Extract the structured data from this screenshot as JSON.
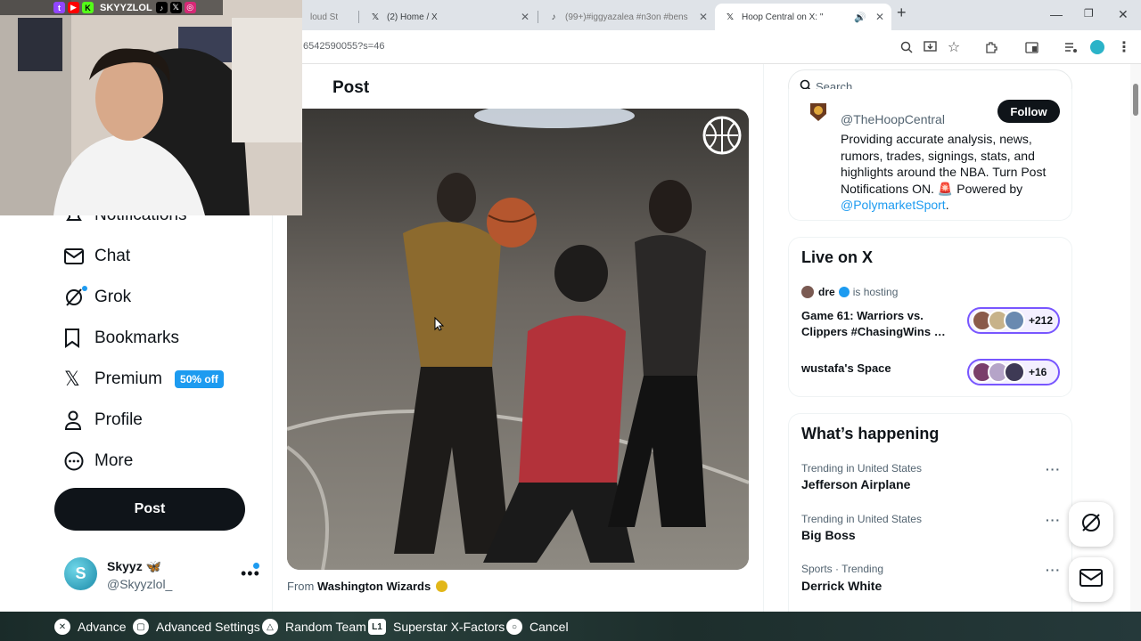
{
  "browser": {
    "tabs": [
      {
        "title": "loud St",
        "active": false
      },
      {
        "title": "(2) Home / X",
        "active": false
      },
      {
        "title": "(99+)#iggyazalea #n3on #bens",
        "active": false
      },
      {
        "title": "Hoop Central on X: \"",
        "active": true
      }
    ],
    "url": "6542590055?s=46"
  },
  "webcam": {
    "handle": "SKYYZLOL"
  },
  "sidebar": {
    "items": [
      {
        "label": "Notifications",
        "icon": "bell-icon"
      },
      {
        "label": "Chat",
        "icon": "mail-icon"
      },
      {
        "label": "Grok",
        "icon": "grok-icon"
      },
      {
        "label": "Bookmarks",
        "icon": "bookmark-icon"
      },
      {
        "label": "Premium",
        "icon": "x-logo-icon"
      },
      {
        "label": "Profile",
        "icon": "person-icon"
      },
      {
        "label": "More",
        "icon": "more-circle-icon"
      }
    ],
    "premium_badge": "50% off",
    "post_button": "Post",
    "account": {
      "name": "Skyyz 🦋",
      "handle": "@Skyyzlol_"
    }
  },
  "main": {
    "title": "Post",
    "from_prefix": "From",
    "from_account": "Washington Wizards"
  },
  "search": {
    "placeholder": "Search"
  },
  "profile_card": {
    "handle": "@TheHoopCentral",
    "follow": "Follow",
    "bio": "Providing accurate analysis, news, rumors, trades, signings, stats, and highlights around the NBA. Turn Post Notifications ON. 🚨 Powered by",
    "bio_link": "@PolymarketSport",
    "bio_end": "."
  },
  "live": {
    "heading": "Live on X",
    "host_name": "dre",
    "host_suffix": "is hosting",
    "spaces": [
      {
        "title": "Game 61: Warriors vs. Clippers #ChasingWins …",
        "count": "+212"
      },
      {
        "title": "wustafa's Space",
        "count": "+16"
      }
    ]
  },
  "happening": {
    "heading": "What’s happening",
    "trends": [
      {
        "context": "Trending in United States",
        "name": "Jefferson Airplane"
      },
      {
        "context": "Trending in United States",
        "name": "Big Boss"
      },
      {
        "context": "Sports · Trending",
        "name": "Derrick White"
      }
    ]
  },
  "gamebar": {
    "items": [
      {
        "button": "✕",
        "label": "Advance"
      },
      {
        "button": "▢",
        "label": "Advanced Settings"
      },
      {
        "button": "△",
        "label": "Random Team"
      },
      {
        "button": "L1",
        "label": "Superstar X-Factors"
      },
      {
        "button": "○",
        "label": "Cancel"
      }
    ]
  },
  "colors": {
    "accent": "#1d9bf0",
    "live_ring": "#7856ff",
    "dark": "#0f1419"
  }
}
